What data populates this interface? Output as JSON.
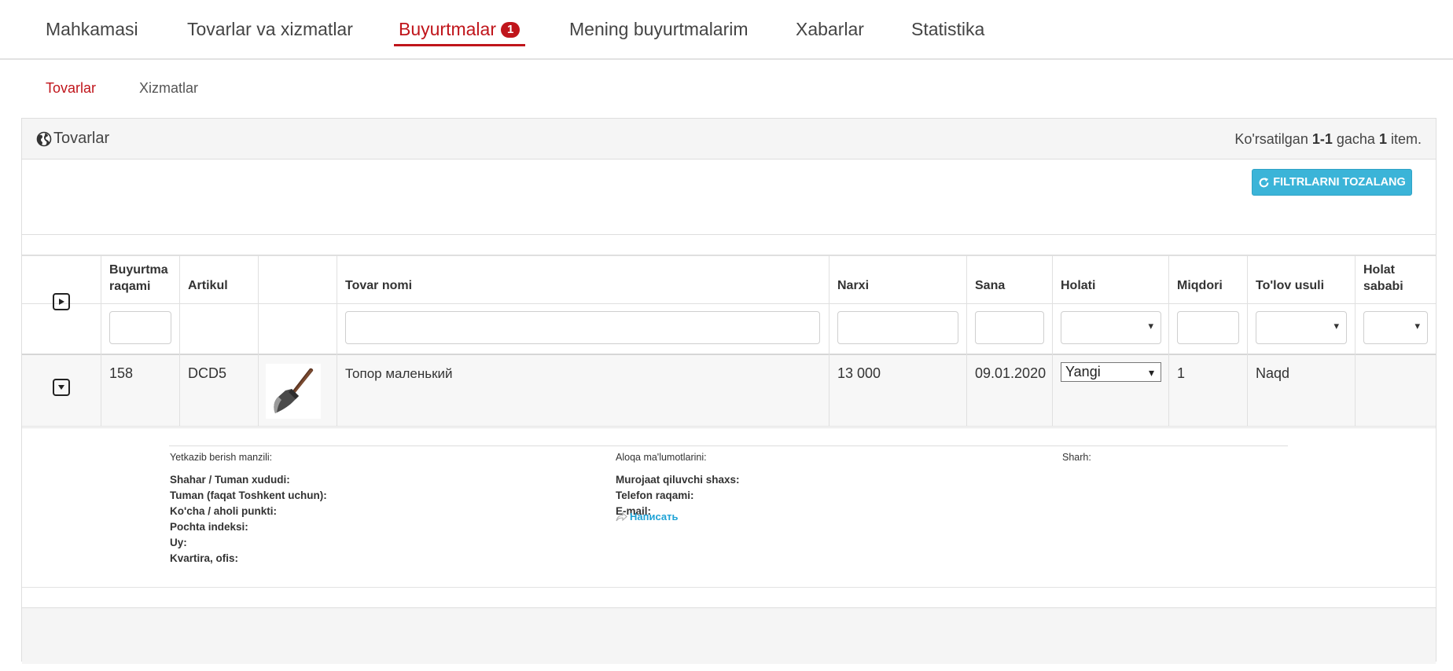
{
  "topnav": {
    "items": [
      {
        "label": "Mahkamasi"
      },
      {
        "label": "Tovarlar va xizmatlar"
      },
      {
        "label": "Buyurtmalar",
        "badge": "1",
        "active": true
      },
      {
        "label": "Mening buyurtmalarim"
      },
      {
        "label": "Xabarlar"
      },
      {
        "label": "Statistika"
      }
    ],
    "accent_color": "#c0151b"
  },
  "subtabs": [
    {
      "label": "Tovarlar",
      "active": true
    },
    {
      "label": "Xizmatlar"
    }
  ],
  "panel": {
    "title": "Tovarlar",
    "summary": {
      "prefix": "Ko'rsatilgan",
      "range": "1-1",
      "middle": "gacha",
      "total": "1",
      "suffix": "item."
    },
    "reset_button": "FILTRLARNI TOZALANG",
    "reset_color": "#3bb4d8"
  },
  "table": {
    "columns": [
      {
        "key": "expand",
        "label": ""
      },
      {
        "key": "order_no",
        "label": "Buyurtma raqami"
      },
      {
        "key": "article",
        "label": "Artikul"
      },
      {
        "key": "image",
        "label": ""
      },
      {
        "key": "name",
        "label": "Tovar nomi"
      },
      {
        "key": "price",
        "label": "Narxi"
      },
      {
        "key": "date",
        "label": "Sana"
      },
      {
        "key": "status",
        "label": "Holati"
      },
      {
        "key": "qty",
        "label": "Miqdori"
      },
      {
        "key": "payment",
        "label": "To'lov usuli"
      },
      {
        "key": "reason",
        "label": "Holat sababi"
      }
    ],
    "rows": [
      {
        "order_no": "158",
        "article": "DCD5",
        "image_icon": "axe-icon",
        "name": "Топор маленький",
        "price": "13 000",
        "date": "09.01.2020",
        "status": "Yangi",
        "qty": "1",
        "payment": "Naqd",
        "reason": ""
      }
    ]
  },
  "details": {
    "delivery_heading": "Yetkazib berish manzili:",
    "contact_heading": "Aloqa ma'lumotlarini:",
    "comment_heading": "Sharh:",
    "delivery_fields": [
      "Shahar / Tuman xududi:",
      "Tuman (faqat Toshkent uchun):",
      "Ko'cha / aholi punkti:",
      "Pochta indeksi:",
      "Uy:",
      "Kvartira, ofis:"
    ],
    "contact_fields": [
      "Murojaat qiluvchi shaxs:",
      "Telefon raqami:",
      "E-mail:"
    ],
    "write_link": "Написать"
  }
}
